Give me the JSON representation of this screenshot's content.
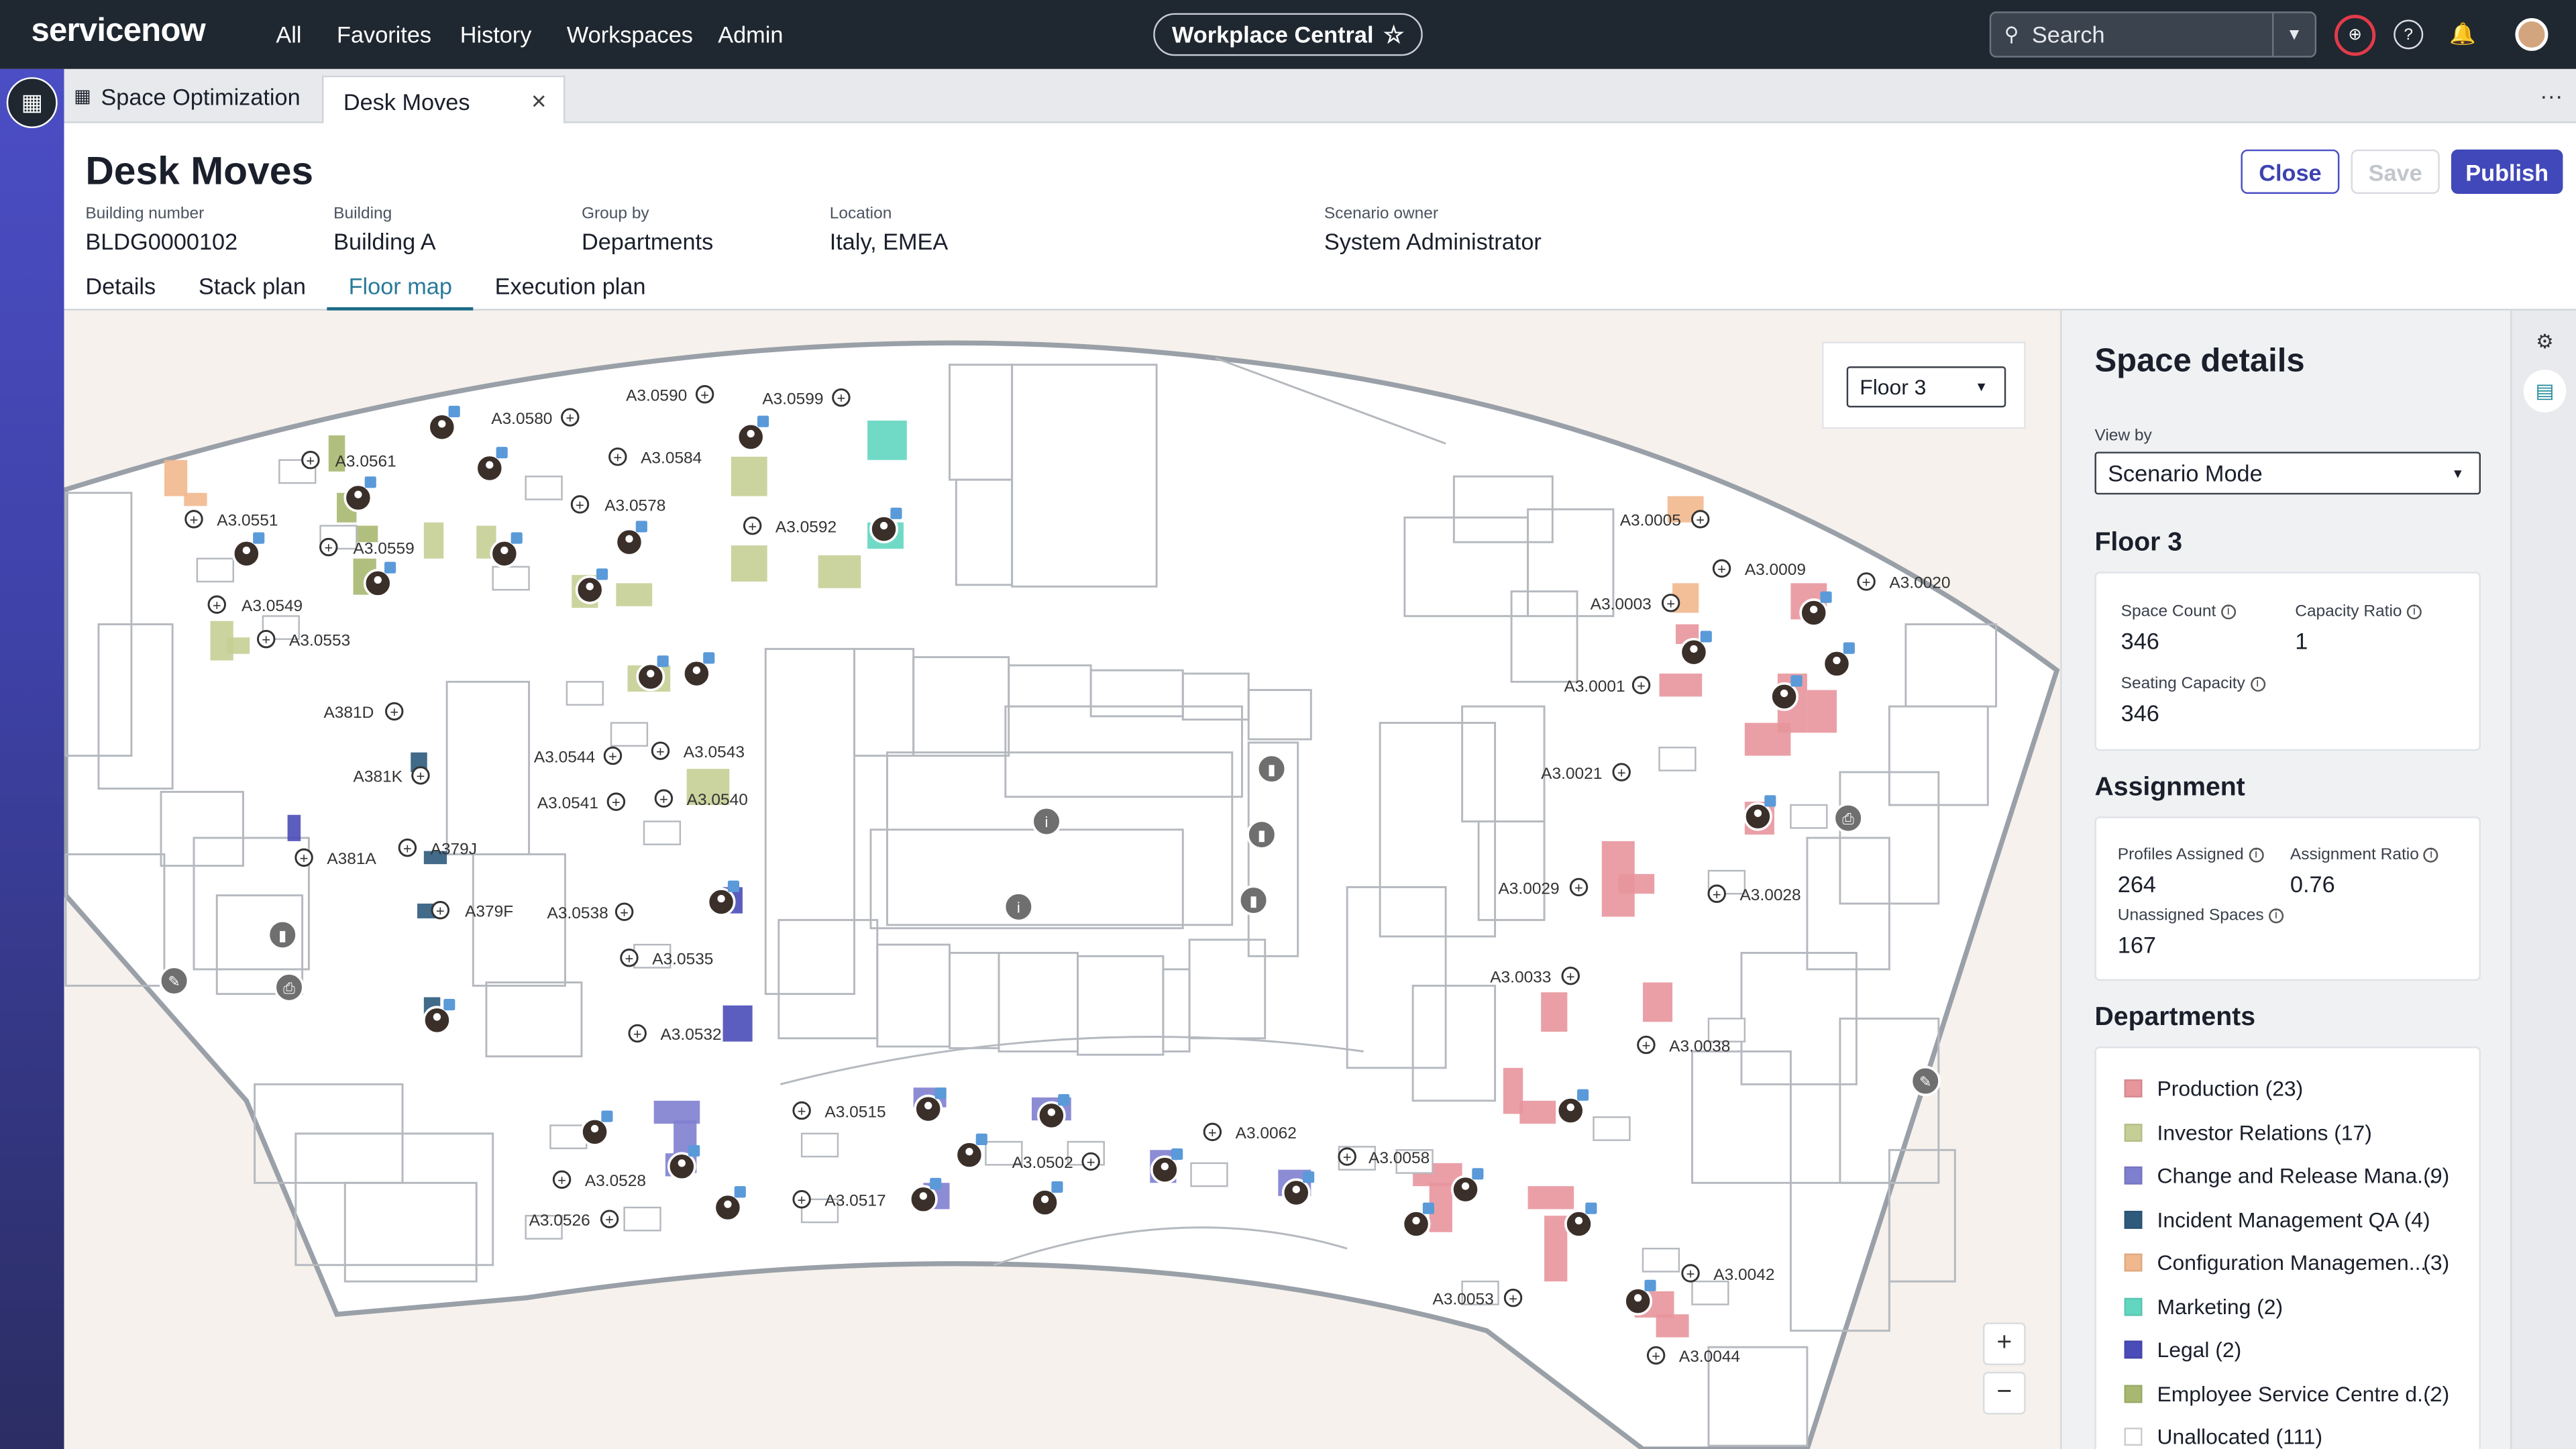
{
  "topbar": {
    "logo": "servicenow",
    "nav": [
      "All",
      "Favorites",
      "History",
      "Workspaces",
      "Admin"
    ],
    "workspace_title": "Workplace Central",
    "search_placeholder": "Search"
  },
  "tabs": {
    "app_tab": "Space Optimization",
    "record_tab": "Desk Moves"
  },
  "record": {
    "title": "Desk Moves",
    "fields": [
      {
        "label": "Building number",
        "value": "BLDG0000102"
      },
      {
        "label": "Building",
        "value": "Building A"
      },
      {
        "label": "Group by",
        "value": "Departments"
      },
      {
        "label": "Location",
        "value": "Italy, EMEA"
      },
      {
        "label": "Scenario owner",
        "value": "System Administrator"
      }
    ],
    "buttons": {
      "close": "Close",
      "save": "Save",
      "publish": "Publish"
    },
    "subtabs": [
      "Details",
      "Stack plan",
      "Floor map",
      "Execution plan"
    ],
    "active_subtab": "Floor map"
  },
  "map": {
    "floor": "Floor 3",
    "zoom_in": "+",
    "zoom_out": "−",
    "space_labels": [
      "A3.0590",
      "A3.0599",
      "A3.0580",
      "A3.0584",
      "A3.0561",
      "A3.0551",
      "A3.0578",
      "A3.0559",
      "A3.0592",
      "A3.0549",
      "A3.0553",
      "A381D",
      "A381K",
      "A3.0544",
      "A3.0543",
      "A3.0541",
      "A3.0540",
      "A379J",
      "A381A",
      "A379F",
      "A3.0538",
      "A3.0535",
      "A3.0532",
      "A3.0515",
      "A3.0528",
      "A3.0526",
      "A3.0517",
      "A3.0502",
      "A3.0062",
      "A3.0058",
      "A3.0053",
      "A3.0005",
      "A3.0009",
      "A3.0020",
      "A3.0003",
      "A3.0001",
      "A3.0021",
      "A3.0029",
      "A3.0028",
      "A3.0033",
      "A3.0038",
      "A3.0042",
      "A3.0044"
    ]
  },
  "space_details": {
    "title": "Space details",
    "view_by_label": "View by",
    "view_by_value": "Scenario Mode",
    "floor_heading": "Floor 3",
    "floor_stats": [
      {
        "label": "Space Count",
        "value": "346"
      },
      {
        "label": "Capacity Ratio",
        "value": "1"
      },
      {
        "label": "Seating Capacity",
        "value": "346"
      }
    ],
    "assignment_heading": "Assignment",
    "assignment_stats": [
      {
        "label": "Profiles Assigned",
        "value": "264"
      },
      {
        "label": "Assignment Ratio",
        "value": "0.76"
      },
      {
        "label": "Unassigned Spaces",
        "value": "167"
      }
    ],
    "departments_heading": "Departments",
    "departments": [
      {
        "name": "Production (23)",
        "count": "",
        "color": "#e8959c"
      },
      {
        "name": "Investor Relations (17)",
        "count": "",
        "color": "#c5cf95"
      },
      {
        "name": "Change and Release Mana...",
        "count": "(9)",
        "color": "#7f7fd0"
      },
      {
        "name": "Incident Management QA (4)",
        "count": "",
        "color": "#2e5a7c"
      },
      {
        "name": "Configuration Managemen...",
        "count": "(3)",
        "color": "#f1b88e"
      },
      {
        "name": "Marketing (2)",
        "count": "",
        "color": "#62d6c0"
      },
      {
        "name": "Legal (2)",
        "count": "",
        "color": "#4a4cb8"
      },
      {
        "name": "Employee Service Centre d...",
        "count": "(2)",
        "color": "#a8b870"
      },
      {
        "name": "Unallocated (111)",
        "count": "",
        "color": "#ffffff"
      }
    ]
  },
  "colors": {
    "topbar": "#1f2730",
    "accent": "#4148b9",
    "active_tab": "#1d6b86"
  }
}
